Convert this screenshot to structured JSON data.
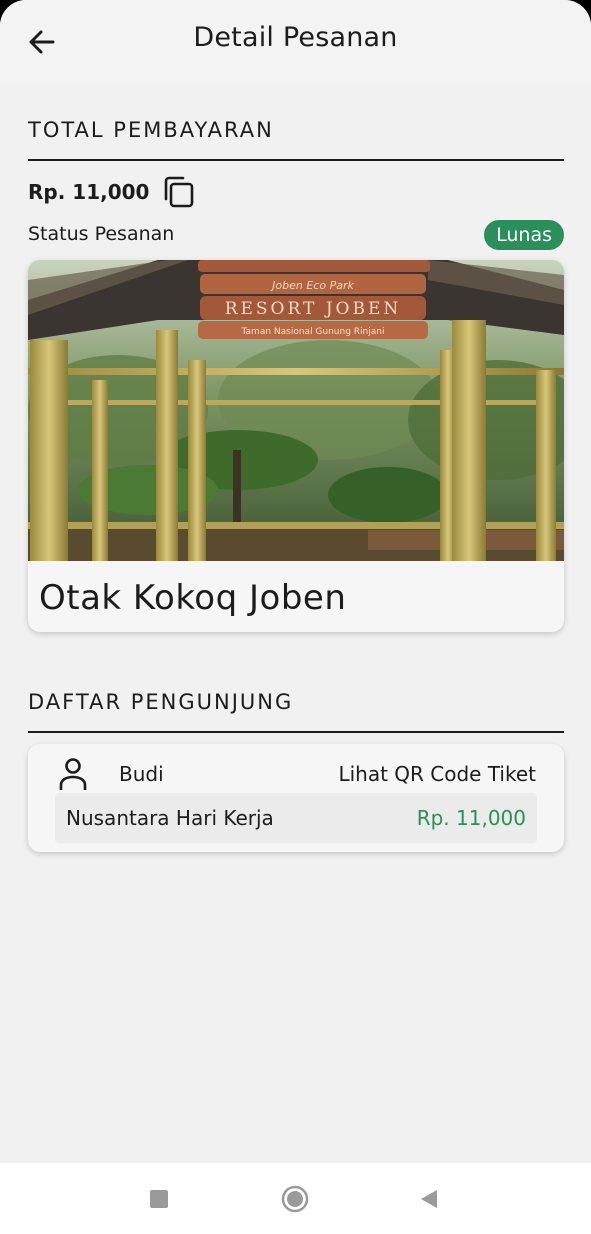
{
  "header": {
    "title": "Detail Pesanan",
    "back_icon": "arrow-left-icon"
  },
  "payment": {
    "heading": "TOTAL PEMBAYARAN",
    "amount": "Rp. 11,000",
    "copy_icon": "copy-icon",
    "status_label": "Status Pesanan",
    "status_value": "Lunas",
    "status_color": "#2b8f5c"
  },
  "destination": {
    "name": "Otak Kokoq Joben",
    "photo_sign_lines": [
      "Joben Eco Park",
      "RESORT JOBEN",
      "Taman Nasional Gunung Rinjani"
    ]
  },
  "visitors": {
    "heading": "DAFTAR PENGUNJUNG",
    "items": [
      {
        "name": "Budi",
        "action": "Lihat QR Code Tiket",
        "ticket_type": "Nusantara Hari Kerja",
        "price": "Rp. 11,000",
        "icon": "person-icon"
      }
    ]
  },
  "system_nav": {
    "recents_icon": "square-icon",
    "home_icon": "circle-icon",
    "back_icon": "triangle-back-icon"
  }
}
